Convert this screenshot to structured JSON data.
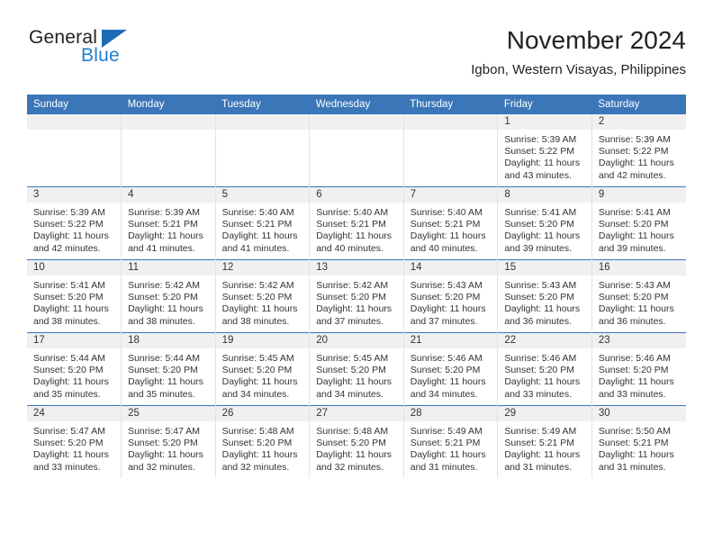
{
  "brand": {
    "name_top": "General",
    "name_bottom": "Blue",
    "triangle_color": "#1b6cb5",
    "blue_color": "#1b7fd4"
  },
  "header": {
    "title": "November 2024",
    "subtitle": "Igbon, Western Visayas, Philippines"
  },
  "theme": {
    "header_bg": "#3a76b8",
    "daynum_bg": "#f0f0f0",
    "cell_border": "#e2e2e2",
    "text": "#333333"
  },
  "weekdays": [
    "Sunday",
    "Monday",
    "Tuesday",
    "Wednesday",
    "Thursday",
    "Friday",
    "Saturday"
  ],
  "weeks": [
    [
      {
        "day": "",
        "lines": []
      },
      {
        "day": "",
        "lines": []
      },
      {
        "day": "",
        "lines": []
      },
      {
        "day": "",
        "lines": []
      },
      {
        "day": "",
        "lines": []
      },
      {
        "day": "1",
        "lines": [
          "Sunrise: 5:39 AM",
          "Sunset: 5:22 PM",
          "Daylight: 11 hours",
          "and 43 minutes."
        ]
      },
      {
        "day": "2",
        "lines": [
          "Sunrise: 5:39 AM",
          "Sunset: 5:22 PM",
          "Daylight: 11 hours",
          "and 42 minutes."
        ]
      }
    ],
    [
      {
        "day": "3",
        "lines": [
          "Sunrise: 5:39 AM",
          "Sunset: 5:22 PM",
          "Daylight: 11 hours",
          "and 42 minutes."
        ]
      },
      {
        "day": "4",
        "lines": [
          "Sunrise: 5:39 AM",
          "Sunset: 5:21 PM",
          "Daylight: 11 hours",
          "and 41 minutes."
        ]
      },
      {
        "day": "5",
        "lines": [
          "Sunrise: 5:40 AM",
          "Sunset: 5:21 PM",
          "Daylight: 11 hours",
          "and 41 minutes."
        ]
      },
      {
        "day": "6",
        "lines": [
          "Sunrise: 5:40 AM",
          "Sunset: 5:21 PM",
          "Daylight: 11 hours",
          "and 40 minutes."
        ]
      },
      {
        "day": "7",
        "lines": [
          "Sunrise: 5:40 AM",
          "Sunset: 5:21 PM",
          "Daylight: 11 hours",
          "and 40 minutes."
        ]
      },
      {
        "day": "8",
        "lines": [
          "Sunrise: 5:41 AM",
          "Sunset: 5:20 PM",
          "Daylight: 11 hours",
          "and 39 minutes."
        ]
      },
      {
        "day": "9",
        "lines": [
          "Sunrise: 5:41 AM",
          "Sunset: 5:20 PM",
          "Daylight: 11 hours",
          "and 39 minutes."
        ]
      }
    ],
    [
      {
        "day": "10",
        "lines": [
          "Sunrise: 5:41 AM",
          "Sunset: 5:20 PM",
          "Daylight: 11 hours",
          "and 38 minutes."
        ]
      },
      {
        "day": "11",
        "lines": [
          "Sunrise: 5:42 AM",
          "Sunset: 5:20 PM",
          "Daylight: 11 hours",
          "and 38 minutes."
        ]
      },
      {
        "day": "12",
        "lines": [
          "Sunrise: 5:42 AM",
          "Sunset: 5:20 PM",
          "Daylight: 11 hours",
          "and 38 minutes."
        ]
      },
      {
        "day": "13",
        "lines": [
          "Sunrise: 5:42 AM",
          "Sunset: 5:20 PM",
          "Daylight: 11 hours",
          "and 37 minutes."
        ]
      },
      {
        "day": "14",
        "lines": [
          "Sunrise: 5:43 AM",
          "Sunset: 5:20 PM",
          "Daylight: 11 hours",
          "and 37 minutes."
        ]
      },
      {
        "day": "15",
        "lines": [
          "Sunrise: 5:43 AM",
          "Sunset: 5:20 PM",
          "Daylight: 11 hours",
          "and 36 minutes."
        ]
      },
      {
        "day": "16",
        "lines": [
          "Sunrise: 5:43 AM",
          "Sunset: 5:20 PM",
          "Daylight: 11 hours",
          "and 36 minutes."
        ]
      }
    ],
    [
      {
        "day": "17",
        "lines": [
          "Sunrise: 5:44 AM",
          "Sunset: 5:20 PM",
          "Daylight: 11 hours",
          "and 35 minutes."
        ]
      },
      {
        "day": "18",
        "lines": [
          "Sunrise: 5:44 AM",
          "Sunset: 5:20 PM",
          "Daylight: 11 hours",
          "and 35 minutes."
        ]
      },
      {
        "day": "19",
        "lines": [
          "Sunrise: 5:45 AM",
          "Sunset: 5:20 PM",
          "Daylight: 11 hours",
          "and 34 minutes."
        ]
      },
      {
        "day": "20",
        "lines": [
          "Sunrise: 5:45 AM",
          "Sunset: 5:20 PM",
          "Daylight: 11 hours",
          "and 34 minutes."
        ]
      },
      {
        "day": "21",
        "lines": [
          "Sunrise: 5:46 AM",
          "Sunset: 5:20 PM",
          "Daylight: 11 hours",
          "and 34 minutes."
        ]
      },
      {
        "day": "22",
        "lines": [
          "Sunrise: 5:46 AM",
          "Sunset: 5:20 PM",
          "Daylight: 11 hours",
          "and 33 minutes."
        ]
      },
      {
        "day": "23",
        "lines": [
          "Sunrise: 5:46 AM",
          "Sunset: 5:20 PM",
          "Daylight: 11 hours",
          "and 33 minutes."
        ]
      }
    ],
    [
      {
        "day": "24",
        "lines": [
          "Sunrise: 5:47 AM",
          "Sunset: 5:20 PM",
          "Daylight: 11 hours",
          "and 33 minutes."
        ]
      },
      {
        "day": "25",
        "lines": [
          "Sunrise: 5:47 AM",
          "Sunset: 5:20 PM",
          "Daylight: 11 hours",
          "and 32 minutes."
        ]
      },
      {
        "day": "26",
        "lines": [
          "Sunrise: 5:48 AM",
          "Sunset: 5:20 PM",
          "Daylight: 11 hours",
          "and 32 minutes."
        ]
      },
      {
        "day": "27",
        "lines": [
          "Sunrise: 5:48 AM",
          "Sunset: 5:20 PM",
          "Daylight: 11 hours",
          "and 32 minutes."
        ]
      },
      {
        "day": "28",
        "lines": [
          "Sunrise: 5:49 AM",
          "Sunset: 5:21 PM",
          "Daylight: 11 hours",
          "and 31 minutes."
        ]
      },
      {
        "day": "29",
        "lines": [
          "Sunrise: 5:49 AM",
          "Sunset: 5:21 PM",
          "Daylight: 11 hours",
          "and 31 minutes."
        ]
      },
      {
        "day": "30",
        "lines": [
          "Sunrise: 5:50 AM",
          "Sunset: 5:21 PM",
          "Daylight: 11 hours",
          "and 31 minutes."
        ]
      }
    ]
  ]
}
